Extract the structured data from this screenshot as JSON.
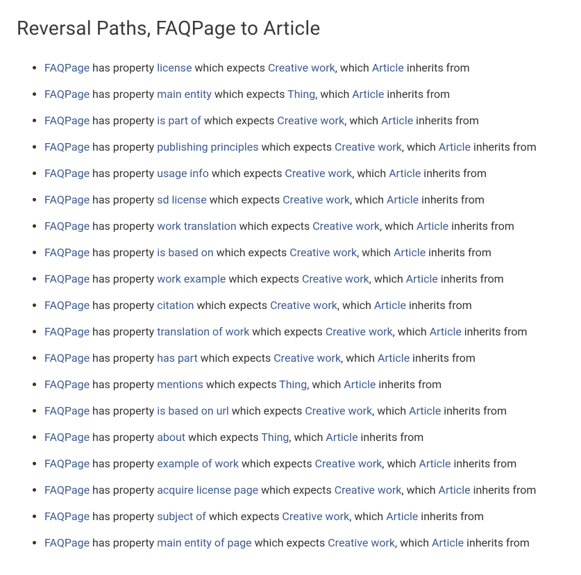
{
  "title": "Reversal Paths, FAQPage to Article",
  "text": {
    "hasProperty": " has property ",
    "whichExpects": " which expects ",
    "commaWhich": ", which ",
    "inheritsFrom": " inherits from"
  },
  "items": [
    {
      "subject": "FAQPage",
      "property": "license",
      "expects": "Creative work",
      "inheritor": "Article"
    },
    {
      "subject": "FAQPage",
      "property": "main entity",
      "expects": "Thing",
      "inheritor": "Article"
    },
    {
      "subject": "FAQPage",
      "property": "is part of",
      "expects": "Creative work",
      "inheritor": "Article"
    },
    {
      "subject": "FAQPage",
      "property": "publishing principles",
      "expects": "Creative work",
      "inheritor": "Article"
    },
    {
      "subject": "FAQPage",
      "property": "usage info",
      "expects": "Creative work",
      "inheritor": "Article"
    },
    {
      "subject": "FAQPage",
      "property": "sd license",
      "expects": "Creative work",
      "inheritor": "Article"
    },
    {
      "subject": "FAQPage",
      "property": "work translation",
      "expects": "Creative work",
      "inheritor": "Article"
    },
    {
      "subject": "FAQPage",
      "property": "is based on",
      "expects": "Creative work",
      "inheritor": "Article"
    },
    {
      "subject": "FAQPage",
      "property": "work example",
      "expects": "Creative work",
      "inheritor": "Article"
    },
    {
      "subject": "FAQPage",
      "property": "citation",
      "expects": "Creative work",
      "inheritor": "Article"
    },
    {
      "subject": "FAQPage",
      "property": "translation of work",
      "expects": "Creative work",
      "inheritor": "Article"
    },
    {
      "subject": "FAQPage",
      "property": "has part",
      "expects": "Creative work",
      "inheritor": "Article"
    },
    {
      "subject": "FAQPage",
      "property": "mentions",
      "expects": "Thing",
      "inheritor": "Article"
    },
    {
      "subject": "FAQPage",
      "property": "is based on url",
      "expects": "Creative work",
      "inheritor": "Article"
    },
    {
      "subject": "FAQPage",
      "property": "about",
      "expects": "Thing",
      "inheritor": "Article"
    },
    {
      "subject": "FAQPage",
      "property": "example of work",
      "expects": "Creative work",
      "inheritor": "Article"
    },
    {
      "subject": "FAQPage",
      "property": "acquire license page",
      "expects": "Creative work",
      "inheritor": "Article"
    },
    {
      "subject": "FAQPage",
      "property": "subject of",
      "expects": "Creative work",
      "inheritor": "Article"
    },
    {
      "subject": "FAQPage",
      "property": "main entity of page",
      "expects": "Creative work",
      "inheritor": "Article"
    }
  ]
}
